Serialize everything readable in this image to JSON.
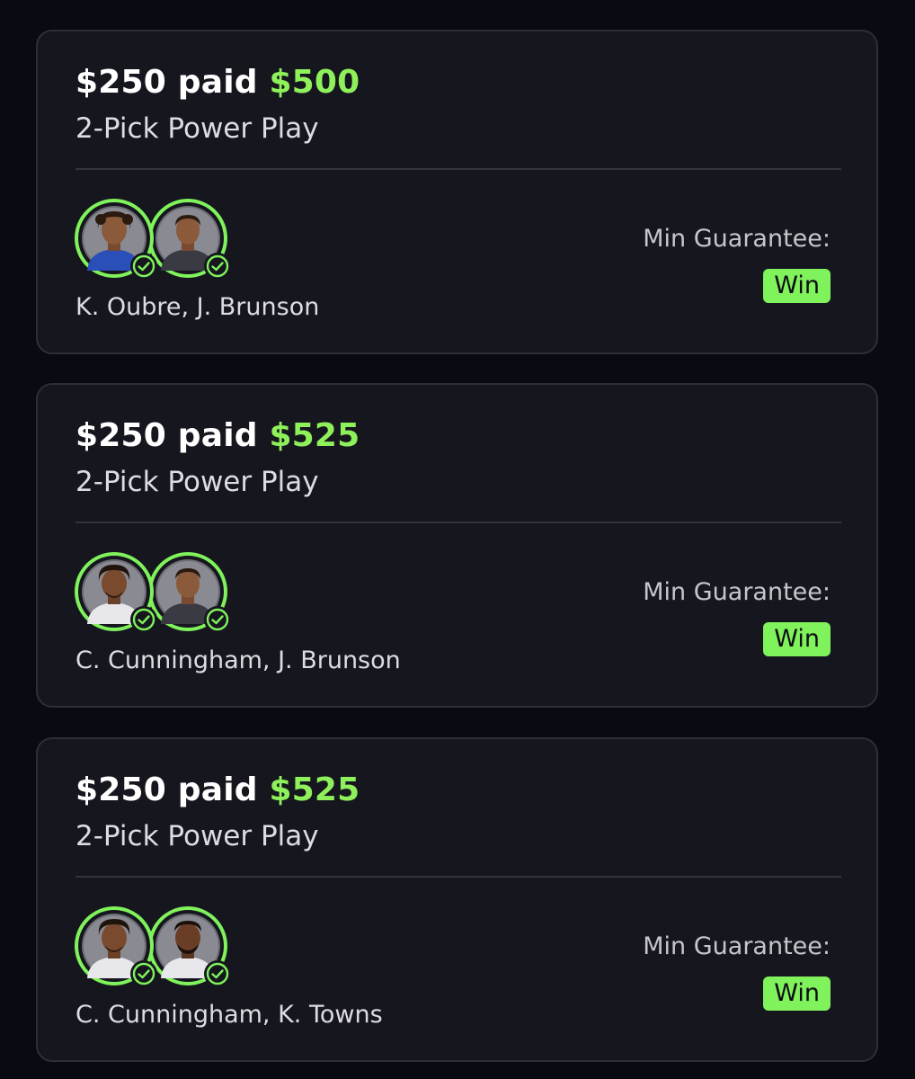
{
  "entries": [
    {
      "stake": "$250 paid",
      "payout": "$500",
      "play_type": "2-Pick Power Play",
      "players": "K. Oubre, J. Brunson",
      "avatars": [
        {
          "name": "K. Oubre",
          "status": "won",
          "jersey_color": "#2a4fb8"
        },
        {
          "name": "J. Brunson",
          "status": "won",
          "jersey_color": "#3a3a42"
        }
      ],
      "min_guarantee_label": "Min Guarantee:",
      "min_guarantee_value": "Win"
    },
    {
      "stake": "$250 paid",
      "payout": "$525",
      "play_type": "2-Pick Power Play",
      "players": "C. Cunningham, J. Brunson",
      "avatars": [
        {
          "name": "C. Cunningham",
          "status": "won",
          "jersey_color": "#e8e8ec"
        },
        {
          "name": "J. Brunson",
          "status": "won",
          "jersey_color": "#3a3a42"
        }
      ],
      "min_guarantee_label": "Min Guarantee:",
      "min_guarantee_value": "Win"
    },
    {
      "stake": "$250 paid",
      "payout": "$525",
      "play_type": "2-Pick Power Play",
      "players": "C. Cunningham, K. Towns",
      "avatars": [
        {
          "name": "C. Cunningham",
          "status": "won",
          "jersey_color": "#e8e8ec"
        },
        {
          "name": "K. Towns",
          "status": "won",
          "jersey_color": "#e8e8ec"
        }
      ],
      "min_guarantee_label": "Min Guarantee:",
      "min_guarantee_value": "Win"
    }
  ],
  "icons": {
    "avatar": "player-headshot-icon",
    "status": "check-circle-icon"
  },
  "colors": {
    "background": "#0a0a12",
    "card": "#16161e",
    "card_border": "#2e2e38",
    "accent_green": "#7ff25c",
    "payout_green": "#8ef05a",
    "text_secondary": "#dcdce2"
  }
}
